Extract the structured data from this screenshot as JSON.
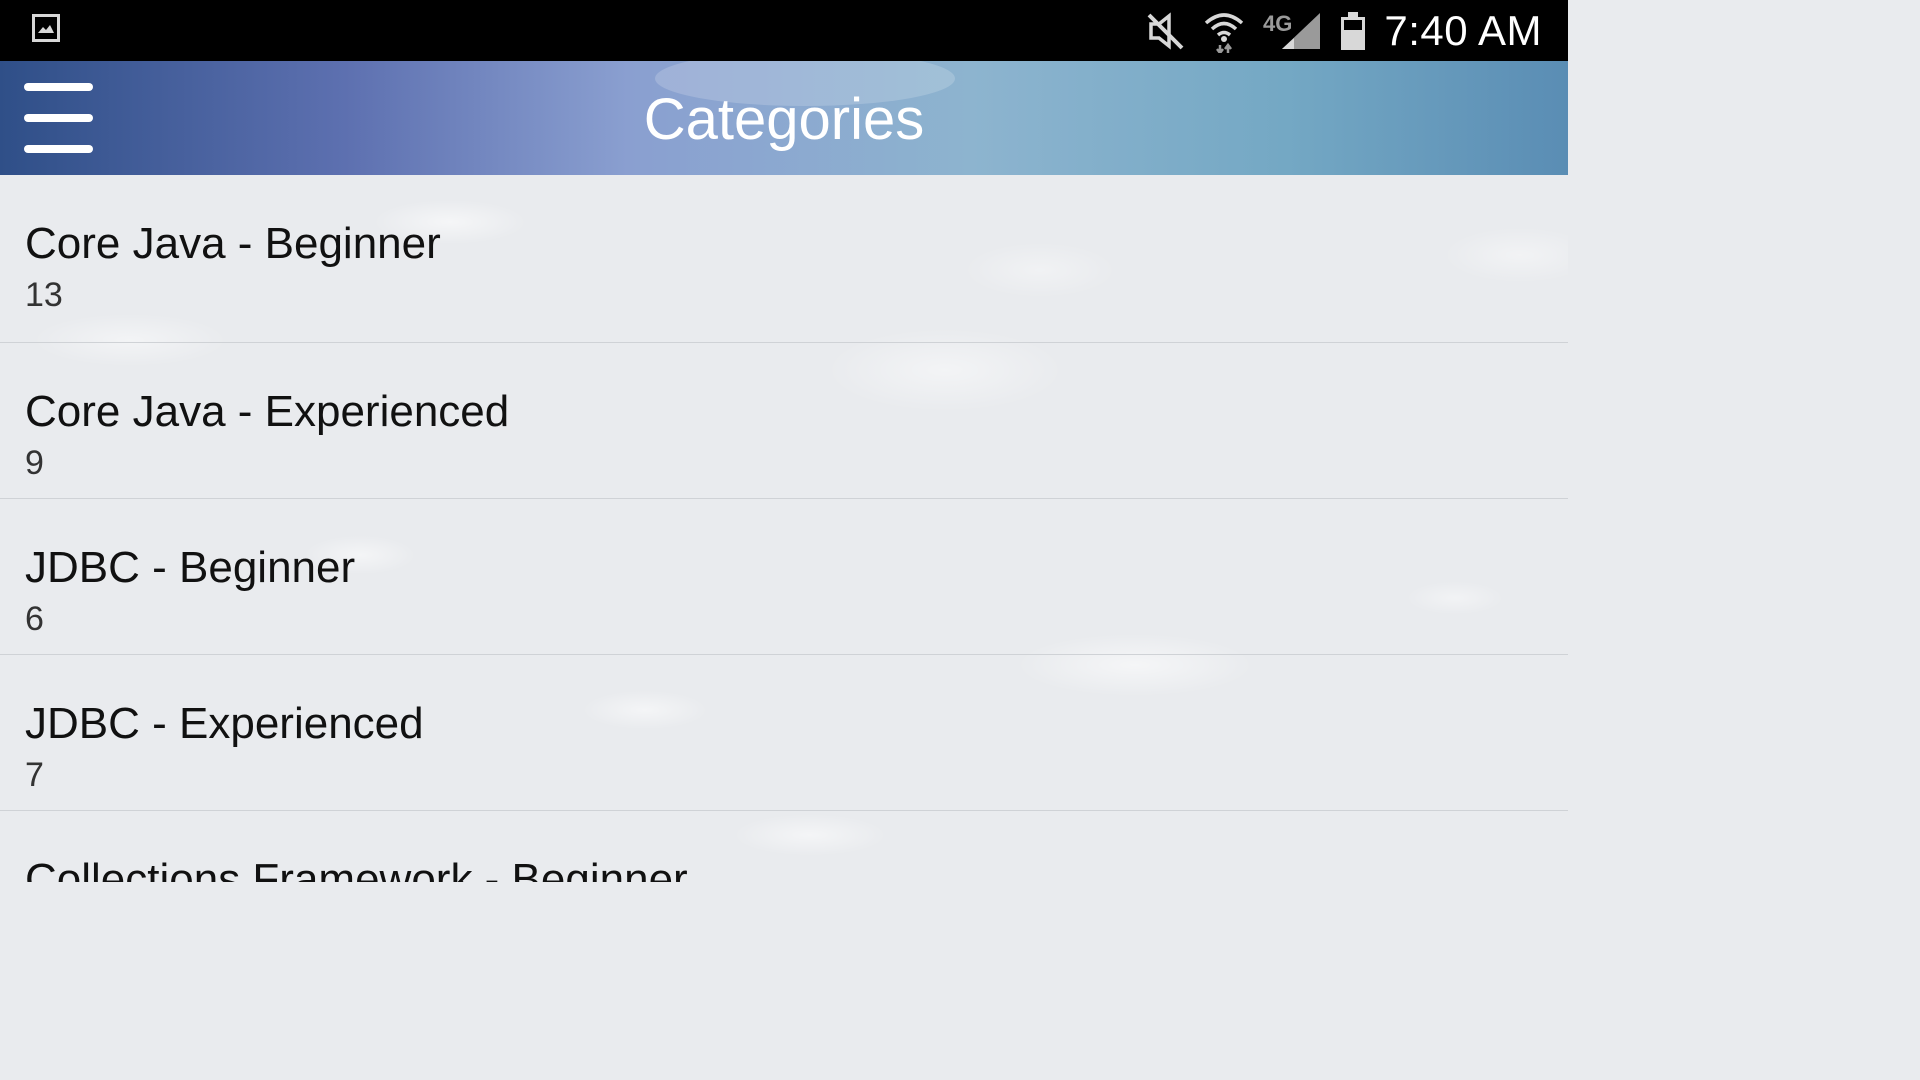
{
  "status_bar": {
    "time": "7:40 AM",
    "network": "4G",
    "icons": [
      "image-icon",
      "mute-icon",
      "wifi-icon",
      "signal-icon",
      "battery-icon"
    ]
  },
  "app_bar": {
    "title": "Categories",
    "menu_icon": "hamburger-menu-icon"
  },
  "categories": [
    {
      "title": "Core Java - Beginner",
      "count": "13"
    },
    {
      "title": "Core Java - Experienced",
      "count": "9"
    },
    {
      "title": "JDBC - Beginner",
      "count": "6"
    },
    {
      "title": "JDBC - Experienced",
      "count": "7"
    },
    {
      "title": "Collections Framework - Beginner",
      "count": ""
    }
  ],
  "colors": {
    "status_bar": "#000000",
    "app_bar_start": "#2f4f88",
    "app_bar_end": "#5a8db4",
    "list_background": "#e9ebee",
    "divider": "#cfd2d6"
  }
}
